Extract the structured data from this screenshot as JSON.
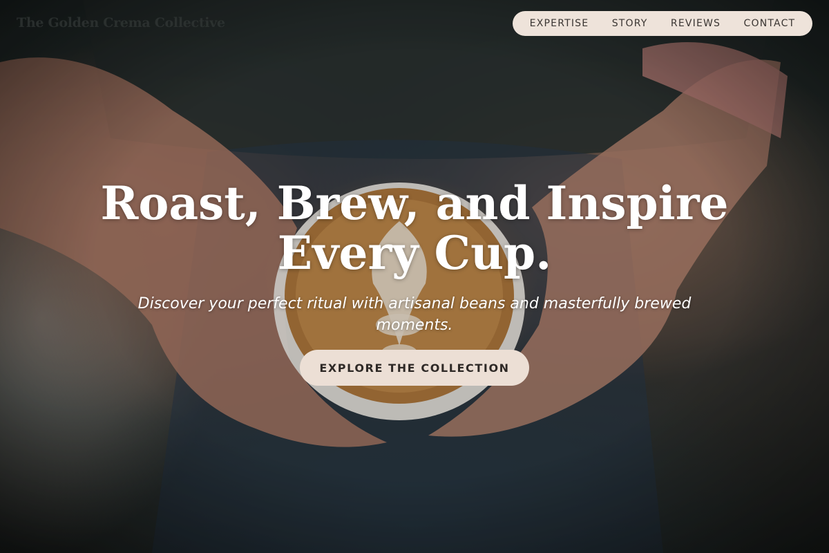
{
  "brand": {
    "logo_text": "The Golden Crema Collective"
  },
  "nav": {
    "items": [
      {
        "label": "EXPERTISE"
      },
      {
        "label": "STORY"
      },
      {
        "label": "REVIEWS"
      },
      {
        "label": "CONTACT"
      }
    ]
  },
  "hero": {
    "headline_line1": "Roast, Brew, and Inspire",
    "headline_line2": "Every Cup.",
    "subtitle": "Discover your perfect ritual with artisanal beans and masterfully brewed moments.",
    "cta_label": "EXPLORE THE COLLECTION",
    "background_image": "hands-holding-latte-photo"
  },
  "colors": {
    "nav_pill_bg": "#eee3da",
    "cta_bg": "#ecdfd5",
    "headline_text": "#ffffff",
    "nav_text": "#3a3532"
  }
}
